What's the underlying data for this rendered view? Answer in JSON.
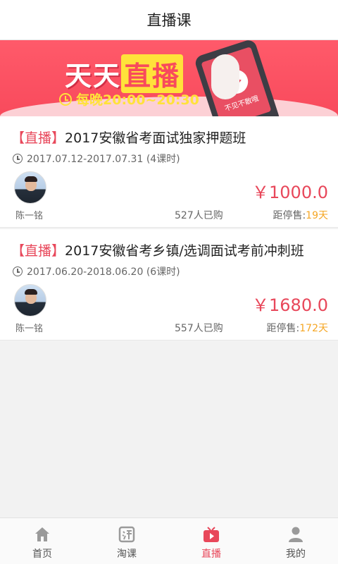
{
  "header": {
    "title": "直播课"
  },
  "banner": {
    "headline_part1": "天天",
    "headline_part2": "直播",
    "time_text": "每晚20:00~20:30",
    "phone_caption": "不见不散哦"
  },
  "courses": [
    {
      "tag": "【直播】",
      "title": "2017安徽省考面试独家押题班",
      "date_range": "2017.07.12-2017.07.31 (4课时)",
      "teacher": "陈一铭",
      "price": "￥1000.0",
      "bought": "527人已购",
      "deadline_label": "距停售:",
      "deadline_days": "19天"
    },
    {
      "tag": "【直播】",
      "title": "2017安徽省考乡镇/选调面试考前冲刺班",
      "date_range": "2017.06.20-2018.06.20 (6课时)",
      "teacher": "陈一铭",
      "price": "￥1680.0",
      "bought": "557人已购",
      "deadline_label": "距停售:",
      "deadline_days": "172天"
    }
  ],
  "tabbar": {
    "items": [
      {
        "label": "首页",
        "icon": "home-icon"
      },
      {
        "label": "淘课",
        "icon": "tao-icon"
      },
      {
        "label": "直播",
        "icon": "tv-icon",
        "active": true
      },
      {
        "label": "我的",
        "icon": "profile-icon"
      }
    ]
  },
  "colors": {
    "accent": "#e8475a",
    "highlight": "#f5a623",
    "banner_bg": "#f84a5c",
    "banner_yellow": "#ffe23a"
  }
}
